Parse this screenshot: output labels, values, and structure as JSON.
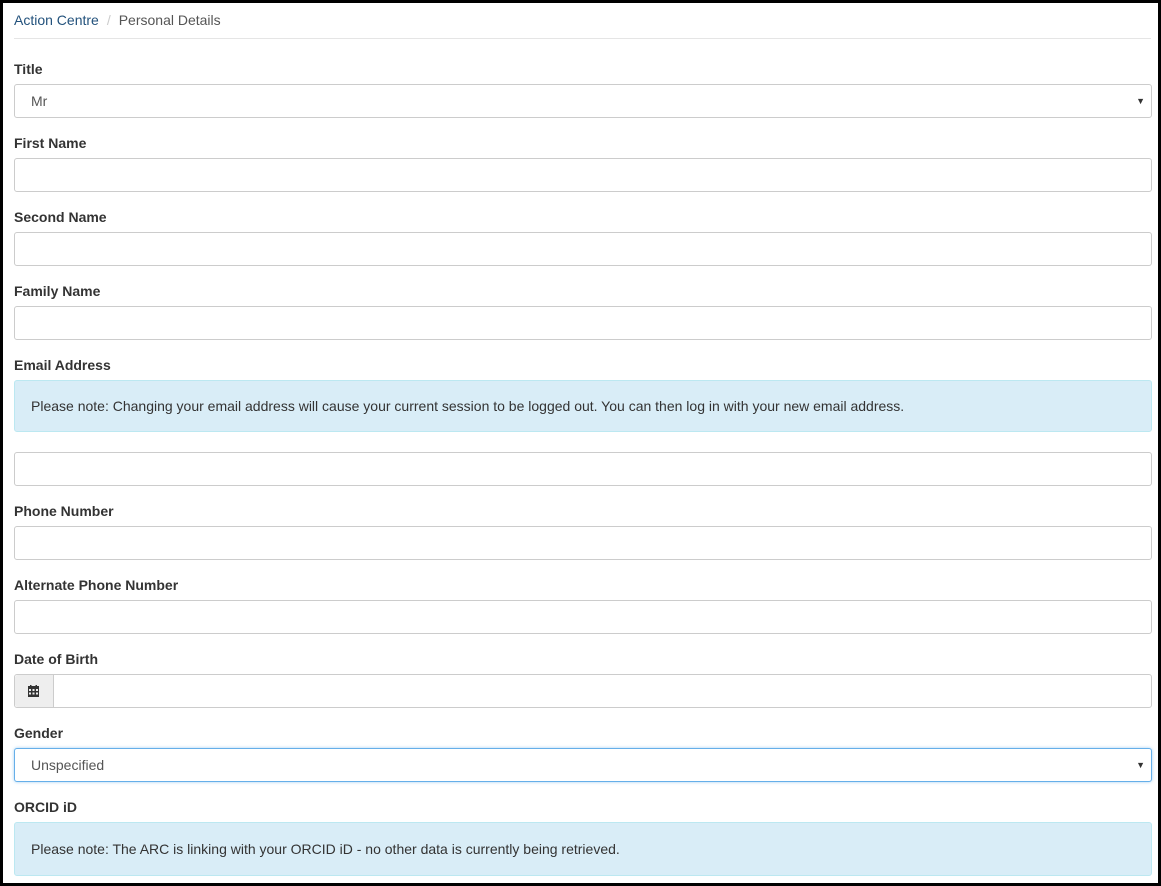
{
  "breadcrumb": {
    "home": "Action Centre",
    "separator": "/",
    "current": "Personal Details"
  },
  "form": {
    "title_label": "Title",
    "title_value": "Mr",
    "first_name_label": "First Name",
    "first_name_value": "",
    "second_name_label": "Second Name",
    "second_name_value": "",
    "family_name_label": "Family Name",
    "family_name_value": "",
    "email_label": "Email Address",
    "email_note": "Please note: Changing your email address will cause your current session to be logged out. You can then log in with your new email address.",
    "email_value": "",
    "phone_label": "Phone Number",
    "phone_value": "",
    "alt_phone_label": "Alternate Phone Number",
    "alt_phone_value": "",
    "dob_label": "Date of Birth",
    "dob_value": "",
    "gender_label": "Gender",
    "gender_value": "Unspecified",
    "orcid_label": "ORCID iD",
    "orcid_note": "Please note: The ARC is linking with your ORCID iD - no other data is currently being retrieved."
  },
  "icons": {
    "dropdown": "chevron-down-icon",
    "date": "calendar-icon"
  },
  "colors": {
    "link": "#23527c",
    "info_background": "#d9edf7",
    "focus_border": "#66afe9"
  }
}
